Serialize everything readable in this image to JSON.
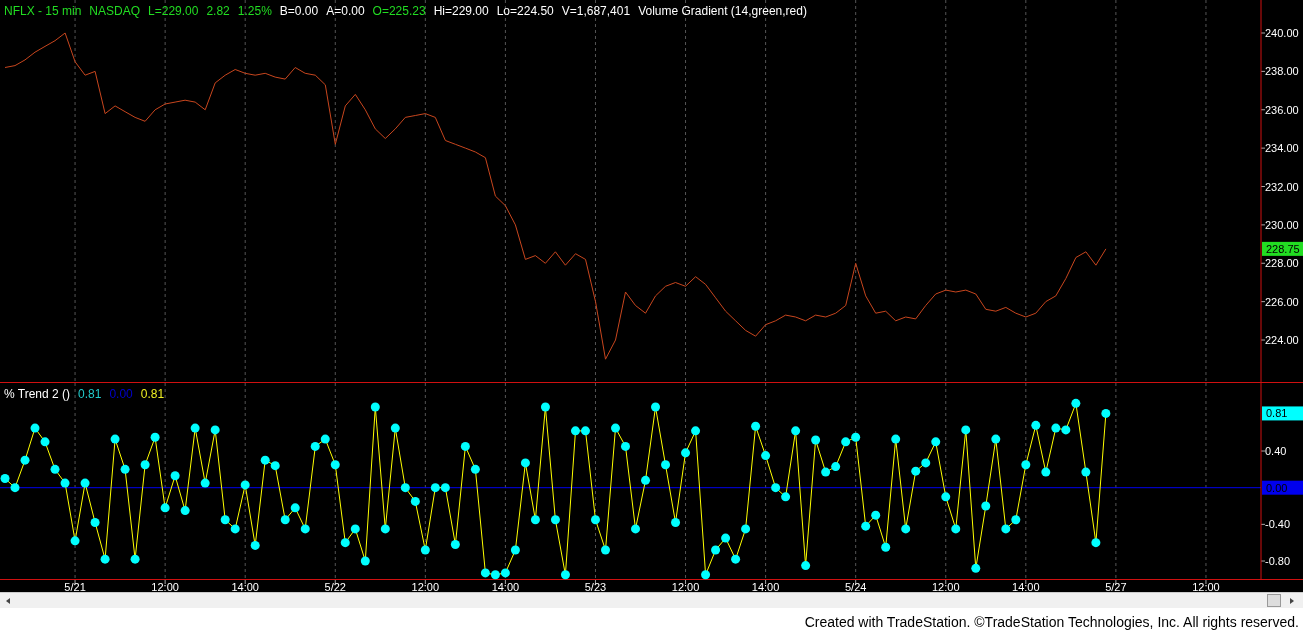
{
  "price_panel": {
    "header": [
      {
        "text": "NFLX - 15 min",
        "color": "#22dd22"
      },
      {
        "text": "NASDAQ",
        "color": "#22dd22"
      },
      {
        "text": "L=229.00",
        "color": "#22dd22"
      },
      {
        "text": "2.82",
        "color": "#22dd22"
      },
      {
        "text": "1.25%",
        "color": "#22dd22"
      },
      {
        "text": "B=0.00",
        "color": "#ffffff"
      },
      {
        "text": "A=0.00",
        "color": "#ffffff"
      },
      {
        "text": "O=225.23",
        "color": "#22dd22"
      },
      {
        "text": "Hi=229.00",
        "color": "#ffffff"
      },
      {
        "text": "Lo=224.50",
        "color": "#ffffff"
      },
      {
        "text": "V=1,687,401",
        "color": "#ffffff"
      },
      {
        "text": "Volume Gradient (14,green,red)",
        "color": "#ffffff"
      }
    ],
    "last_value": {
      "text": "228.75",
      "color": "#22dd22"
    },
    "chart_data": {
      "type": "line",
      "grid": true,
      "ylim": [
        221.76,
        241.72
      ],
      "yticks": [
        {
          "value": 224,
          "label": "224.00"
        },
        {
          "value": 226,
          "label": "226.00"
        },
        {
          "value": 228,
          "label": "228.00"
        },
        {
          "value": 230,
          "label": "230.00"
        },
        {
          "value": 232,
          "label": "232.00"
        },
        {
          "value": 234,
          "label": "234.00"
        },
        {
          "value": 236,
          "label": "236.00"
        },
        {
          "value": 238,
          "label": "238.00"
        },
        {
          "value": 240,
          "label": "240.00"
        }
      ],
      "series": [
        {
          "color": "#c8461e",
          "values": [
            238.2,
            238.3,
            238.6,
            239.0,
            239.3,
            239.6,
            240.0,
            238.5,
            237.8,
            238.0,
            235.8,
            236.2,
            235.9,
            235.6,
            235.4,
            236.0,
            236.3,
            236.4,
            236.5,
            236.4,
            236.0,
            237.4,
            237.8,
            238.1,
            237.9,
            237.8,
            237.9,
            237.7,
            237.6,
            238.2,
            237.9,
            237.8,
            237.3,
            234.2,
            236.2,
            236.8,
            236.0,
            235.0,
            234.5,
            235.0,
            235.6,
            235.7,
            235.8,
            235.6,
            234.4,
            234.2,
            234.0,
            233.8,
            233.5,
            231.5,
            231.0,
            230.0,
            228.2,
            228.4,
            228.0,
            228.6,
            227.9,
            228.5,
            228.2,
            226.0,
            223.0,
            224.0,
            226.5,
            225.8,
            225.4,
            226.3,
            226.8,
            227.0,
            226.8,
            227.3,
            226.9,
            226.2,
            225.5,
            225.0,
            224.5,
            224.2,
            224.8,
            225.0,
            225.3,
            225.2,
            225.0,
            225.3,
            225.2,
            225.4,
            225.8,
            228.0,
            226.3,
            225.4,
            225.5,
            225.0,
            225.2,
            225.1,
            225.8,
            226.4,
            226.6,
            226.5,
            226.6,
            226.4,
            225.6,
            225.5,
            225.7,
            225.4,
            225.2,
            225.4,
            226.0,
            226.3,
            227.2,
            228.3,
            228.6,
            227.9,
            228.75
          ]
        }
      ]
    }
  },
  "indicator_panel": {
    "header": [
      {
        "text": "% Trend 2 ()",
        "color": "#ffffff"
      },
      {
        "text": "0.81",
        "color": "#22cccc"
      },
      {
        "text": "0.00",
        "color": "#0000cc"
      },
      {
        "text": "0.81",
        "color": "#eeee22"
      }
    ],
    "last_values": [
      {
        "text": "0.81",
        "color": "#00ffff"
      }
    ],
    "chart_data": {
      "type": "line",
      "grid": true,
      "ylim": [
        -1.007,
        1.142
      ],
      "yticks": [
        {
          "value": -0.8,
          "label": "-0.80"
        },
        {
          "value": -0.4,
          "label": "-0.40"
        },
        {
          "value": 0,
          "label": "0.00"
        },
        {
          "value": 0.4,
          "label": "0.40"
        }
      ],
      "ref_lines": [
        {
          "axis": "y",
          "value": 0,
          "color": "#0000ee"
        }
      ],
      "categories": [
        null,
        null,
        null,
        null,
        null,
        null,
        null,
        "5/21",
        null,
        null,
        null,
        null,
        null,
        null,
        null,
        null,
        "12:00",
        null,
        null,
        null,
        null,
        null,
        null,
        null,
        "14:00",
        null,
        null,
        null,
        null,
        null,
        null,
        null,
        null,
        "5/22",
        null,
        null,
        null,
        null,
        null,
        null,
        null,
        null,
        "12:00",
        null,
        null,
        null,
        null,
        null,
        null,
        null,
        "14:00",
        null,
        null,
        null,
        null,
        null,
        null,
        null,
        null,
        "5/23",
        null,
        null,
        null,
        null,
        null,
        null,
        null,
        null,
        "12:00",
        null,
        null,
        null,
        null,
        null,
        null,
        null,
        "14:00",
        null,
        null,
        null,
        null,
        null,
        null,
        null,
        null,
        "5/24",
        null,
        null,
        null,
        null,
        null,
        null,
        null,
        null,
        "12:00",
        null,
        null,
        null,
        null,
        null,
        null,
        null,
        "14:00",
        null,
        null,
        null,
        null,
        null,
        null,
        null,
        null,
        "5/27",
        null,
        null,
        null,
        null,
        null,
        null,
        null,
        null,
        "12:00",
        null,
        null,
        null,
        null,
        null
      ],
      "series": [
        {
          "color": "#ffff00",
          "marker": "o",
          "values": [
            0.1,
            0.0,
            0.3,
            0.65,
            0.5,
            0.2,
            0.05,
            -0.58,
            0.05,
            -0.38,
            -0.78,
            0.53,
            0.2,
            -0.78,
            0.25,
            0.55,
            -0.22,
            0.13,
            -0.25,
            0.65,
            0.05,
            0.63,
            -0.35,
            -0.45,
            0.03,
            -0.63,
            0.3,
            0.24,
            -0.35,
            -0.22,
            -0.45,
            0.45,
            0.53,
            0.25,
            -0.6,
            -0.45,
            -0.8,
            0.88,
            -0.45,
            0.65,
            0.0,
            -0.15,
            -0.68,
            0.0,
            0.0,
            -0.62,
            0.45,
            0.2,
            -0.93,
            -0.95,
            -0.93,
            -0.68,
            0.27,
            -0.35,
            0.88,
            -0.35,
            -0.95,
            0.62,
            0.62,
            -0.35,
            -0.68,
            0.65,
            0.45,
            -0.45,
            0.08,
            0.88,
            0.25,
            -0.38,
            0.38,
            0.62,
            -0.95,
            -0.68,
            -0.55,
            -0.78,
            -0.45,
            0.67,
            0.35,
            0.0,
            -0.1,
            0.62,
            -0.85,
            0.52,
            0.17,
            0.23,
            0.5,
            0.55,
            -0.42,
            -0.3,
            -0.65,
            0.53,
            -0.45,
            0.18,
            0.27,
            0.5,
            -0.1,
            -0.45,
            0.63,
            -0.88,
            -0.2,
            0.53,
            -0.45,
            -0.35,
            0.25,
            0.68,
            0.17,
            0.65,
            0.63,
            0.92,
            0.17,
            -0.6,
            0.81,
            null,
            null,
            null,
            null,
            null,
            null,
            null,
            null,
            null,
            null,
            null,
            null,
            null,
            null,
            null
          ]
        }
      ]
    }
  },
  "footer": "Created with TradeStation. ©TradeStation Technologies, Inc. All rights reserved."
}
